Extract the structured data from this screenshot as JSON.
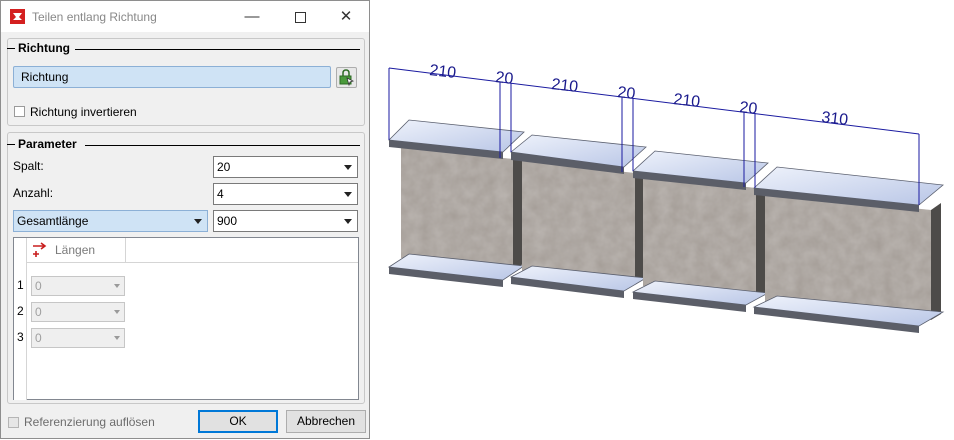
{
  "window": {
    "title": "Teilen entlang Richtung"
  },
  "richtung": {
    "section_label": "Richtung",
    "field_value": "Richtung",
    "invert_label": "Richtung invertieren",
    "invert_checked": false
  },
  "parameter": {
    "section_label": "Parameter",
    "spalt_label": "Spalt:",
    "spalt_value": "20",
    "anzahl_label": "Anzahl:",
    "anzahl_value": "4",
    "mode_value": "Gesamtlänge",
    "total_value": "900"
  },
  "table": {
    "column_header": "Längen",
    "rows": [
      {
        "num": "1",
        "value": "0"
      },
      {
        "num": "2",
        "value": "0"
      },
      {
        "num": "3",
        "value": "0"
      }
    ]
  },
  "footer": {
    "reference_label": "Referenzierung auflösen",
    "ok_label": "OK",
    "cancel_label": "Abbrechen"
  },
  "dimensions": {
    "labels": [
      "210",
      "20",
      "210",
      "20",
      "210",
      "20",
      "310"
    ]
  },
  "colors": {
    "field_blue": "#cfe3f5",
    "dimension_line": "#1a1aa0",
    "flange": "#c9d3ec",
    "web": "#a39c96"
  }
}
